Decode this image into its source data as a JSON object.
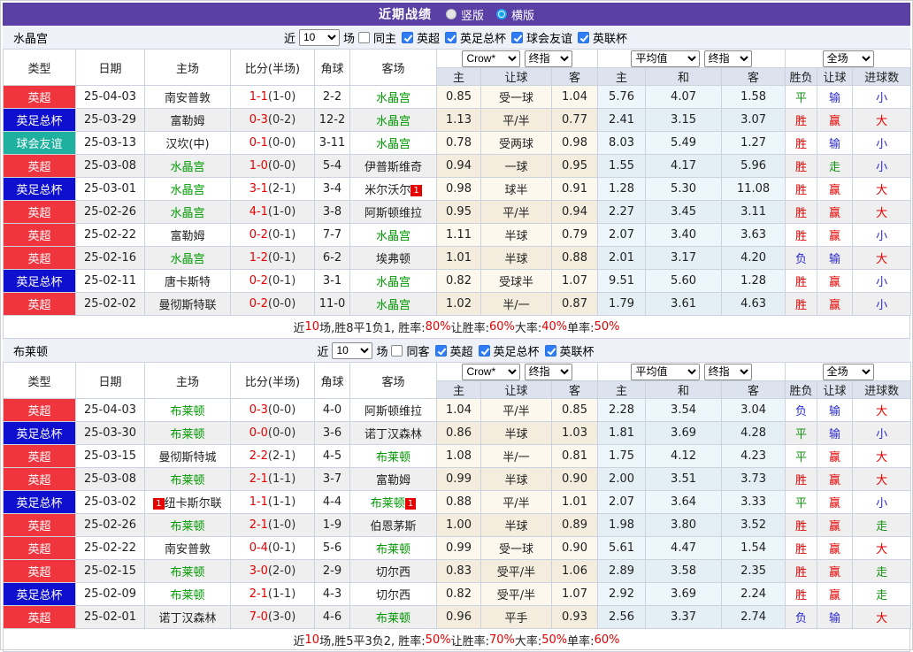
{
  "title_bar": {
    "title": "近期战绩",
    "view_options": [
      {
        "label": "竖版",
        "selected": false
      },
      {
        "label": "横版",
        "selected": true
      }
    ]
  },
  "table_header": {
    "left_columns": [
      "类型",
      "日期",
      "主场",
      "比分(半场)",
      "角球",
      "客场"
    ],
    "odds_group_selects": [
      "Crow*",
      "终指"
    ],
    "avg_group_selects": [
      "平均值",
      "终指"
    ],
    "scope_select": "全场",
    "sub_columns": [
      "主",
      "让球",
      "客",
      "主",
      "和",
      "客",
      "胜负",
      "让球",
      "进球数"
    ]
  },
  "league_colors": {
    "英超": "red",
    "英足总杯": "blue",
    "球会友谊": "teal",
    "英联杯": "red"
  },
  "result_colors": {
    "胜": "r",
    "赢": "r",
    "大": "r",
    "平": "g",
    "走": "g",
    "负": "b",
    "输": "b",
    "小": "b"
  },
  "sections": [
    {
      "team": "水晶宫",
      "controls": {
        "near": "近",
        "count": "10",
        "matches": "场",
        "same_venue": "同主",
        "leagues": [
          "英超",
          "英足总杯",
          "球会友谊",
          "英联杯"
        ]
      },
      "rows": [
        {
          "league": "英超",
          "date": "25-04-03",
          "home": "南安普敦",
          "home_green": false,
          "home_card": "",
          "score": "1-1",
          "half": "(1-0)",
          "corner": "2-2",
          "away": "水晶宫",
          "away_green": true,
          "away_card": "",
          "odds": [
            "0.85",
            "受一球",
            "1.04"
          ],
          "avg": [
            "5.76",
            "4.07",
            "1.58"
          ],
          "res": [
            "平",
            "输",
            "小"
          ]
        },
        {
          "league": "英足总杯",
          "date": "25-03-29",
          "home": "富勒姆",
          "home_green": false,
          "home_card": "",
          "score": "0-3",
          "half": "(0-2)",
          "corner": "12-2",
          "away": "水晶宫",
          "away_green": true,
          "away_card": "",
          "odds": [
            "1.13",
            "平/半",
            "0.77"
          ],
          "avg": [
            "2.41",
            "3.15",
            "3.07"
          ],
          "res": [
            "胜",
            "赢",
            "大"
          ]
        },
        {
          "league": "球会友谊",
          "date": "25-03-13",
          "home": "汉坎(中)",
          "home_green": false,
          "home_card": "",
          "score": "0-1",
          "half": "(0-0)",
          "corner": "3-11",
          "away": "水晶宫",
          "away_green": true,
          "away_card": "",
          "odds": [
            "0.78",
            "受两球",
            "0.98"
          ],
          "avg": [
            "8.03",
            "5.49",
            "1.27"
          ],
          "res": [
            "胜",
            "输",
            "小"
          ]
        },
        {
          "league": "英超",
          "date": "25-03-08",
          "home": "水晶宫",
          "home_green": true,
          "home_card": "",
          "score": "1-0",
          "half": "(0-0)",
          "corner": "5-4",
          "away": "伊普斯维奇",
          "away_green": false,
          "away_card": "",
          "odds": [
            "0.94",
            "一球",
            "0.95"
          ],
          "avg": [
            "1.55",
            "4.17",
            "5.96"
          ],
          "res": [
            "胜",
            "走",
            "小"
          ]
        },
        {
          "league": "英足总杯",
          "date": "25-03-01",
          "home": "水晶宫",
          "home_green": true,
          "home_card": "",
          "score": "3-1",
          "half": "(2-1)",
          "corner": "3-4",
          "away": "米尔沃尔",
          "away_green": false,
          "away_card": "1",
          "odds": [
            "0.98",
            "球半",
            "0.91"
          ],
          "avg": [
            "1.28",
            "5.30",
            "11.08"
          ],
          "res": [
            "胜",
            "赢",
            "大"
          ]
        },
        {
          "league": "英超",
          "date": "25-02-26",
          "home": "水晶宫",
          "home_green": true,
          "home_card": "",
          "score": "4-1",
          "half": "(1-0)",
          "corner": "3-8",
          "away": "阿斯顿维拉",
          "away_green": false,
          "away_card": "",
          "odds": [
            "0.95",
            "平/半",
            "0.94"
          ],
          "avg": [
            "2.27",
            "3.45",
            "3.11"
          ],
          "res": [
            "胜",
            "赢",
            "大"
          ]
        },
        {
          "league": "英超",
          "date": "25-02-22",
          "home": "富勒姆",
          "home_green": false,
          "home_card": "",
          "score": "0-2",
          "half": "(0-1)",
          "corner": "7-7",
          "away": "水晶宫",
          "away_green": true,
          "away_card": "",
          "odds": [
            "1.11",
            "半球",
            "0.79"
          ],
          "avg": [
            "2.07",
            "3.40",
            "3.63"
          ],
          "res": [
            "胜",
            "赢",
            "小"
          ]
        },
        {
          "league": "英超",
          "date": "25-02-16",
          "home": "水晶宫",
          "home_green": true,
          "home_card": "",
          "score": "1-2",
          "half": "(0-1)",
          "corner": "6-2",
          "away": "埃弗顿",
          "away_green": false,
          "away_card": "",
          "odds": [
            "1.01",
            "半球",
            "0.88"
          ],
          "avg": [
            "2.01",
            "3.17",
            "4.20"
          ],
          "res": [
            "负",
            "输",
            "大"
          ]
        },
        {
          "league": "英足总杯",
          "date": "25-02-11",
          "home": "唐卡斯特",
          "home_green": false,
          "home_card": "",
          "score": "0-2",
          "half": "(0-1)",
          "corner": "3-1",
          "away": "水晶宫",
          "away_green": true,
          "away_card": "",
          "odds": [
            "0.82",
            "受球半",
            "1.07"
          ],
          "avg": [
            "9.51",
            "5.60",
            "1.28"
          ],
          "res": [
            "胜",
            "赢",
            "小"
          ]
        },
        {
          "league": "英超",
          "date": "25-02-02",
          "home": "曼彻斯特联",
          "home_green": false,
          "home_card": "",
          "score": "0-2",
          "half": "(0-0)",
          "corner": "11-0",
          "away": "水晶宫",
          "away_green": true,
          "away_card": "",
          "odds": [
            "1.02",
            "半/一",
            "0.87"
          ],
          "avg": [
            "1.79",
            "3.61",
            "4.63"
          ],
          "res": [
            "胜",
            "赢",
            "小"
          ]
        }
      ],
      "summary": [
        {
          "t": "近"
        },
        {
          "t": "10",
          "red": true
        },
        {
          "t": "场,胜8平1负1, 胜率:"
        },
        {
          "t": "80%",
          "red": true
        },
        {
          "t": " 让胜率:"
        },
        {
          "t": "60%",
          "red": true
        },
        {
          "t": " 大率:"
        },
        {
          "t": "40%",
          "red": true
        },
        {
          "t": " 单率:"
        },
        {
          "t": "50%",
          "red": true
        }
      ]
    },
    {
      "team": "布莱顿",
      "controls": {
        "near": "近",
        "count": "10",
        "matches": "场",
        "same_venue": "同客",
        "leagues": [
          "英超",
          "英足总杯",
          "英联杯"
        ]
      },
      "rows": [
        {
          "league": "英超",
          "date": "25-04-03",
          "home": "布莱顿",
          "home_green": true,
          "home_card": "",
          "score": "0-3",
          "half": "(0-0)",
          "corner": "4-0",
          "away": "阿斯顿维拉",
          "away_green": false,
          "away_card": "",
          "odds": [
            "1.04",
            "平/半",
            "0.85"
          ],
          "avg": [
            "2.28",
            "3.54",
            "3.04"
          ],
          "res": [
            "负",
            "输",
            "大"
          ]
        },
        {
          "league": "英足总杯",
          "date": "25-03-30",
          "home": "布莱顿",
          "home_green": true,
          "home_card": "",
          "score": "0-0",
          "half": "(0-0)",
          "corner": "3-6",
          "away": "诺丁汉森林",
          "away_green": false,
          "away_card": "",
          "odds": [
            "0.86",
            "半球",
            "1.03"
          ],
          "avg": [
            "1.81",
            "3.69",
            "4.28"
          ],
          "res": [
            "平",
            "输",
            "小"
          ]
        },
        {
          "league": "英超",
          "date": "25-03-15",
          "home": "曼彻斯特城",
          "home_green": false,
          "home_card": "",
          "score": "2-2",
          "half": "(2-1)",
          "corner": "4-5",
          "away": "布莱顿",
          "away_green": true,
          "away_card": "",
          "odds": [
            "1.08",
            "半/一",
            "0.81"
          ],
          "avg": [
            "1.75",
            "4.12",
            "4.23"
          ],
          "res": [
            "平",
            "赢",
            "大"
          ]
        },
        {
          "league": "英超",
          "date": "25-03-08",
          "home": "布莱顿",
          "home_green": true,
          "home_card": "",
          "score": "2-1",
          "half": "(1-1)",
          "corner": "3-7",
          "away": "富勒姆",
          "away_green": false,
          "away_card": "",
          "odds": [
            "0.99",
            "半球",
            "0.90"
          ],
          "avg": [
            "2.00",
            "3.51",
            "3.73"
          ],
          "res": [
            "胜",
            "赢",
            "大"
          ]
        },
        {
          "league": "英足总杯",
          "date": "25-03-02",
          "home": "纽卡斯尔联",
          "home_green": false,
          "home_card": "1",
          "score": "1-1",
          "half": "(1-1)",
          "corner": "4-4",
          "away": "布莱顿",
          "away_green": true,
          "away_card": "1",
          "odds": [
            "0.88",
            "平/半",
            "1.01"
          ],
          "avg": [
            "2.07",
            "3.64",
            "3.33"
          ],
          "res": [
            "平",
            "赢",
            "小"
          ]
        },
        {
          "league": "英超",
          "date": "25-02-26",
          "home": "布莱顿",
          "home_green": true,
          "home_card": "",
          "score": "2-1",
          "half": "(1-0)",
          "corner": "1-9",
          "away": "伯恩茅斯",
          "away_green": false,
          "away_card": "",
          "odds": [
            "1.00",
            "半球",
            "0.89"
          ],
          "avg": [
            "1.98",
            "3.80",
            "3.52"
          ],
          "res": [
            "胜",
            "赢",
            "走"
          ]
        },
        {
          "league": "英超",
          "date": "25-02-22",
          "home": "南安普敦",
          "home_green": false,
          "home_card": "",
          "score": "0-4",
          "half": "(0-1)",
          "corner": "5-6",
          "away": "布莱顿",
          "away_green": true,
          "away_card": "",
          "odds": [
            "0.99",
            "受一球",
            "0.90"
          ],
          "avg": [
            "5.61",
            "4.47",
            "1.54"
          ],
          "res": [
            "胜",
            "赢",
            "大"
          ]
        },
        {
          "league": "英超",
          "date": "25-02-15",
          "home": "布莱顿",
          "home_green": true,
          "home_card": "",
          "score": "3-0",
          "half": "(2-0)",
          "corner": "2-9",
          "away": "切尔西",
          "away_green": false,
          "away_card": "",
          "odds": [
            "0.83",
            "受平/半",
            "1.06"
          ],
          "avg": [
            "2.89",
            "3.58",
            "2.35"
          ],
          "res": [
            "胜",
            "赢",
            "走"
          ]
        },
        {
          "league": "英足总杯",
          "date": "25-02-09",
          "home": "布莱顿",
          "home_green": true,
          "home_card": "",
          "score": "2-1",
          "half": "(1-1)",
          "corner": "4-3",
          "away": "切尔西",
          "away_green": false,
          "away_card": "",
          "odds": [
            "0.82",
            "受平/半",
            "1.07"
          ],
          "avg": [
            "2.92",
            "3.69",
            "2.24"
          ],
          "res": [
            "胜",
            "赢",
            "走"
          ]
        },
        {
          "league": "英超",
          "date": "25-02-01",
          "home": "诺丁汉森林",
          "home_green": false,
          "home_card": "",
          "score": "7-0",
          "half": "(3-0)",
          "corner": "4-6",
          "away": "布莱顿",
          "away_green": true,
          "away_card": "",
          "odds": [
            "0.96",
            "平手",
            "0.93"
          ],
          "avg": [
            "2.56",
            "3.37",
            "2.74"
          ],
          "res": [
            "负",
            "输",
            "大"
          ]
        }
      ],
      "summary": [
        {
          "t": "近"
        },
        {
          "t": "10",
          "red": true
        },
        {
          "t": "场,胜5平3负2, 胜率:"
        },
        {
          "t": "50%",
          "red": true
        },
        {
          "t": " 让胜率:"
        },
        {
          "t": "70%",
          "red": true
        },
        {
          "t": " 大率:"
        },
        {
          "t": "50%",
          "red": true
        },
        {
          "t": " 单率:"
        },
        {
          "t": "60%",
          "red": true
        }
      ]
    }
  ]
}
